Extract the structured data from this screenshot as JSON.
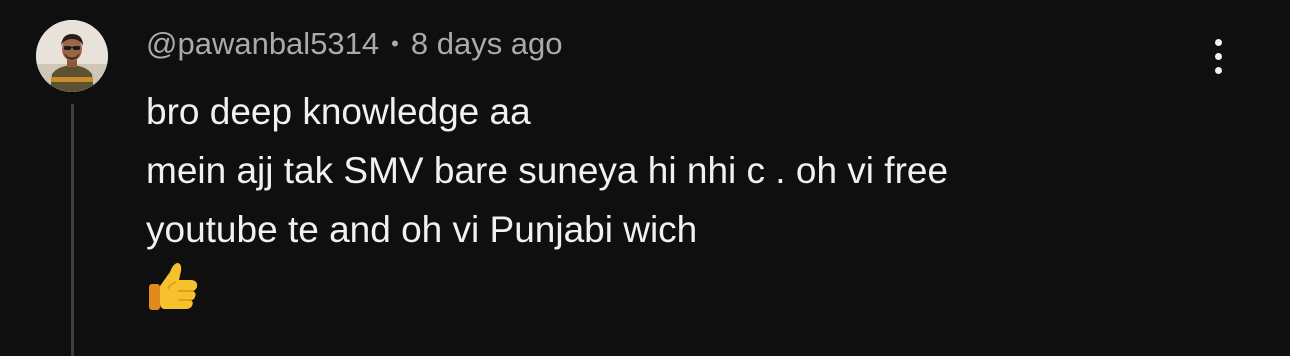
{
  "comment": {
    "author": "@pawanbal5314",
    "separator": "•",
    "timestamp": "8 days ago",
    "text_lines": [
      "bro deep knowledge aa",
      "mein ajj tak SMV bare suneya hi nhi c . oh vi free",
      "youtube te and oh vi Punjabi wich"
    ],
    "emoji": "thumbs-up"
  },
  "icons": {
    "menu": "more-vertical-icon",
    "avatar": "user-avatar-photo"
  },
  "colors": {
    "background": "#0f0f0f",
    "text_primary": "#f1f1f1",
    "text_secondary": "#aaaaaa",
    "thread_line": "#3d3d3d"
  }
}
